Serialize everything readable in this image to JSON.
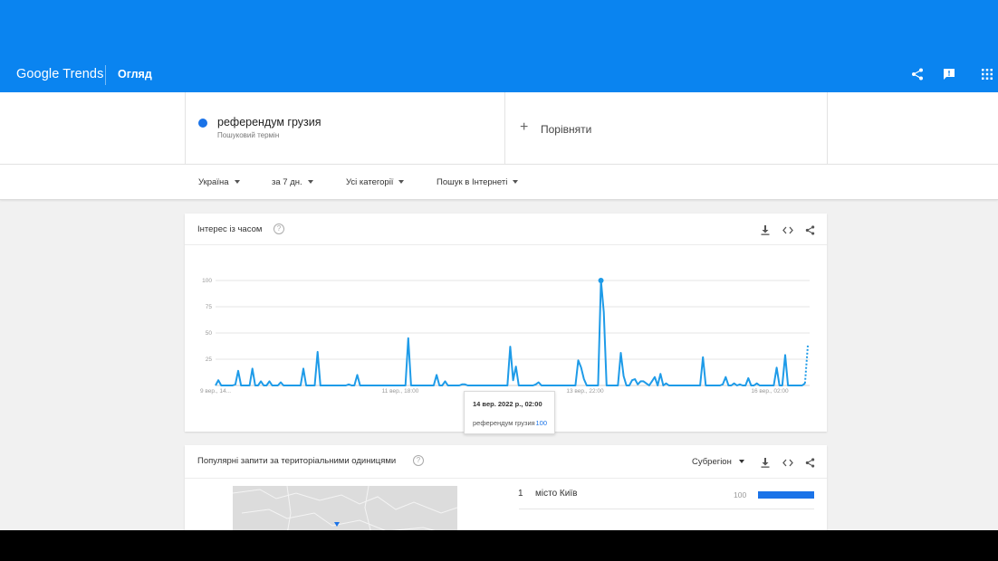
{
  "header": {
    "logo_google": "Google",
    "logo_trends": "Trends",
    "page_title": "Огляд",
    "icons": [
      "share-icon",
      "feedback-icon",
      "apps-icon"
    ]
  },
  "search_term": {
    "term": "референдум грузия",
    "sublabel": "Пошуковий термін",
    "dot_color": "#1a73e8"
  },
  "compare": {
    "plus": "+",
    "label": "Порівняти"
  },
  "filters": [
    {
      "label": "Україна"
    },
    {
      "label": "за 7 дн."
    },
    {
      "label": "Усі категорії"
    },
    {
      "label": "Пошук в Інтернеті"
    }
  ],
  "interest_card": {
    "title": "Інтерес із часом",
    "help": "?"
  },
  "chart_data": {
    "type": "line",
    "y_ticks": [
      "100",
      "75",
      "50",
      "25"
    ],
    "x_ticks": [
      "9 вер., 14...",
      "11 вер., 18:00",
      "13 вер., 22:00",
      "16 вер., 02:00"
    ],
    "ylim": [
      0,
      100
    ],
    "grid": true,
    "line_color": "#1e9be8",
    "series": [
      {
        "values": [
          0,
          5,
          0,
          0,
          0,
          0,
          0,
          1,
          14,
          0,
          0,
          0,
          0,
          16,
          0,
          0,
          4,
          0,
          0,
          4,
          0,
          0,
          0,
          3,
          0,
          0,
          0,
          0,
          0,
          0,
          0,
          16,
          0,
          0,
          0,
          0,
          32,
          0,
          0,
          0,
          0,
          0,
          0,
          0,
          0,
          0,
          0,
          1,
          0,
          0,
          10,
          0,
          0,
          0,
          0,
          0,
          0,
          0,
          0,
          0,
          0,
          0,
          0,
          0,
          0,
          0,
          0,
          0,
          45,
          0,
          0,
          0,
          0,
          0,
          0,
          0,
          0,
          0,
          10,
          0,
          0,
          4,
          0,
          0,
          0,
          0,
          0,
          1,
          1,
          0,
          0,
          0,
          0,
          0,
          0,
          0,
          0,
          0,
          0,
          0,
          0,
          0,
          0,
          0,
          37,
          5,
          18,
          0,
          0,
          0,
          0,
          0,
          0,
          1,
          3,
          0,
          0,
          0,
          0,
          0,
          0,
          0,
          0,
          0,
          0,
          0,
          0,
          0,
          24,
          17,
          6,
          0,
          0,
          0,
          0,
          0,
          100,
          70,
          0,
          0,
          0,
          0,
          0,
          31,
          9,
          0,
          0,
          5,
          6,
          1,
          4,
          4,
          2,
          0,
          4,
          8,
          0,
          11,
          0,
          2,
          0,
          0,
          0,
          0,
          0,
          0,
          0,
          0,
          0,
          0,
          0,
          0,
          27,
          0,
          0,
          0,
          0,
          0,
          0,
          1,
          8,
          0,
          0,
          2,
          0,
          1,
          0,
          0,
          7,
          0,
          0,
          2,
          0,
          0,
          0,
          0,
          0,
          0,
          17,
          0,
          0,
          29,
          0,
          0,
          0,
          0,
          0,
          0,
          2,
          38
        ]
      }
    ],
    "peak_label": "100",
    "tooltip": {
      "date": "14 вер. 2022 р., 02:00",
      "term": "референдум грузия",
      "value": "100"
    }
  },
  "regions_card": {
    "title": "Популярні запити за територіальними одиницями",
    "help": "?",
    "resolution": "Субрегіон",
    "rows": [
      {
        "rank": "1",
        "name": "місто Київ",
        "value": "100",
        "fraction": 1.0
      }
    ]
  }
}
